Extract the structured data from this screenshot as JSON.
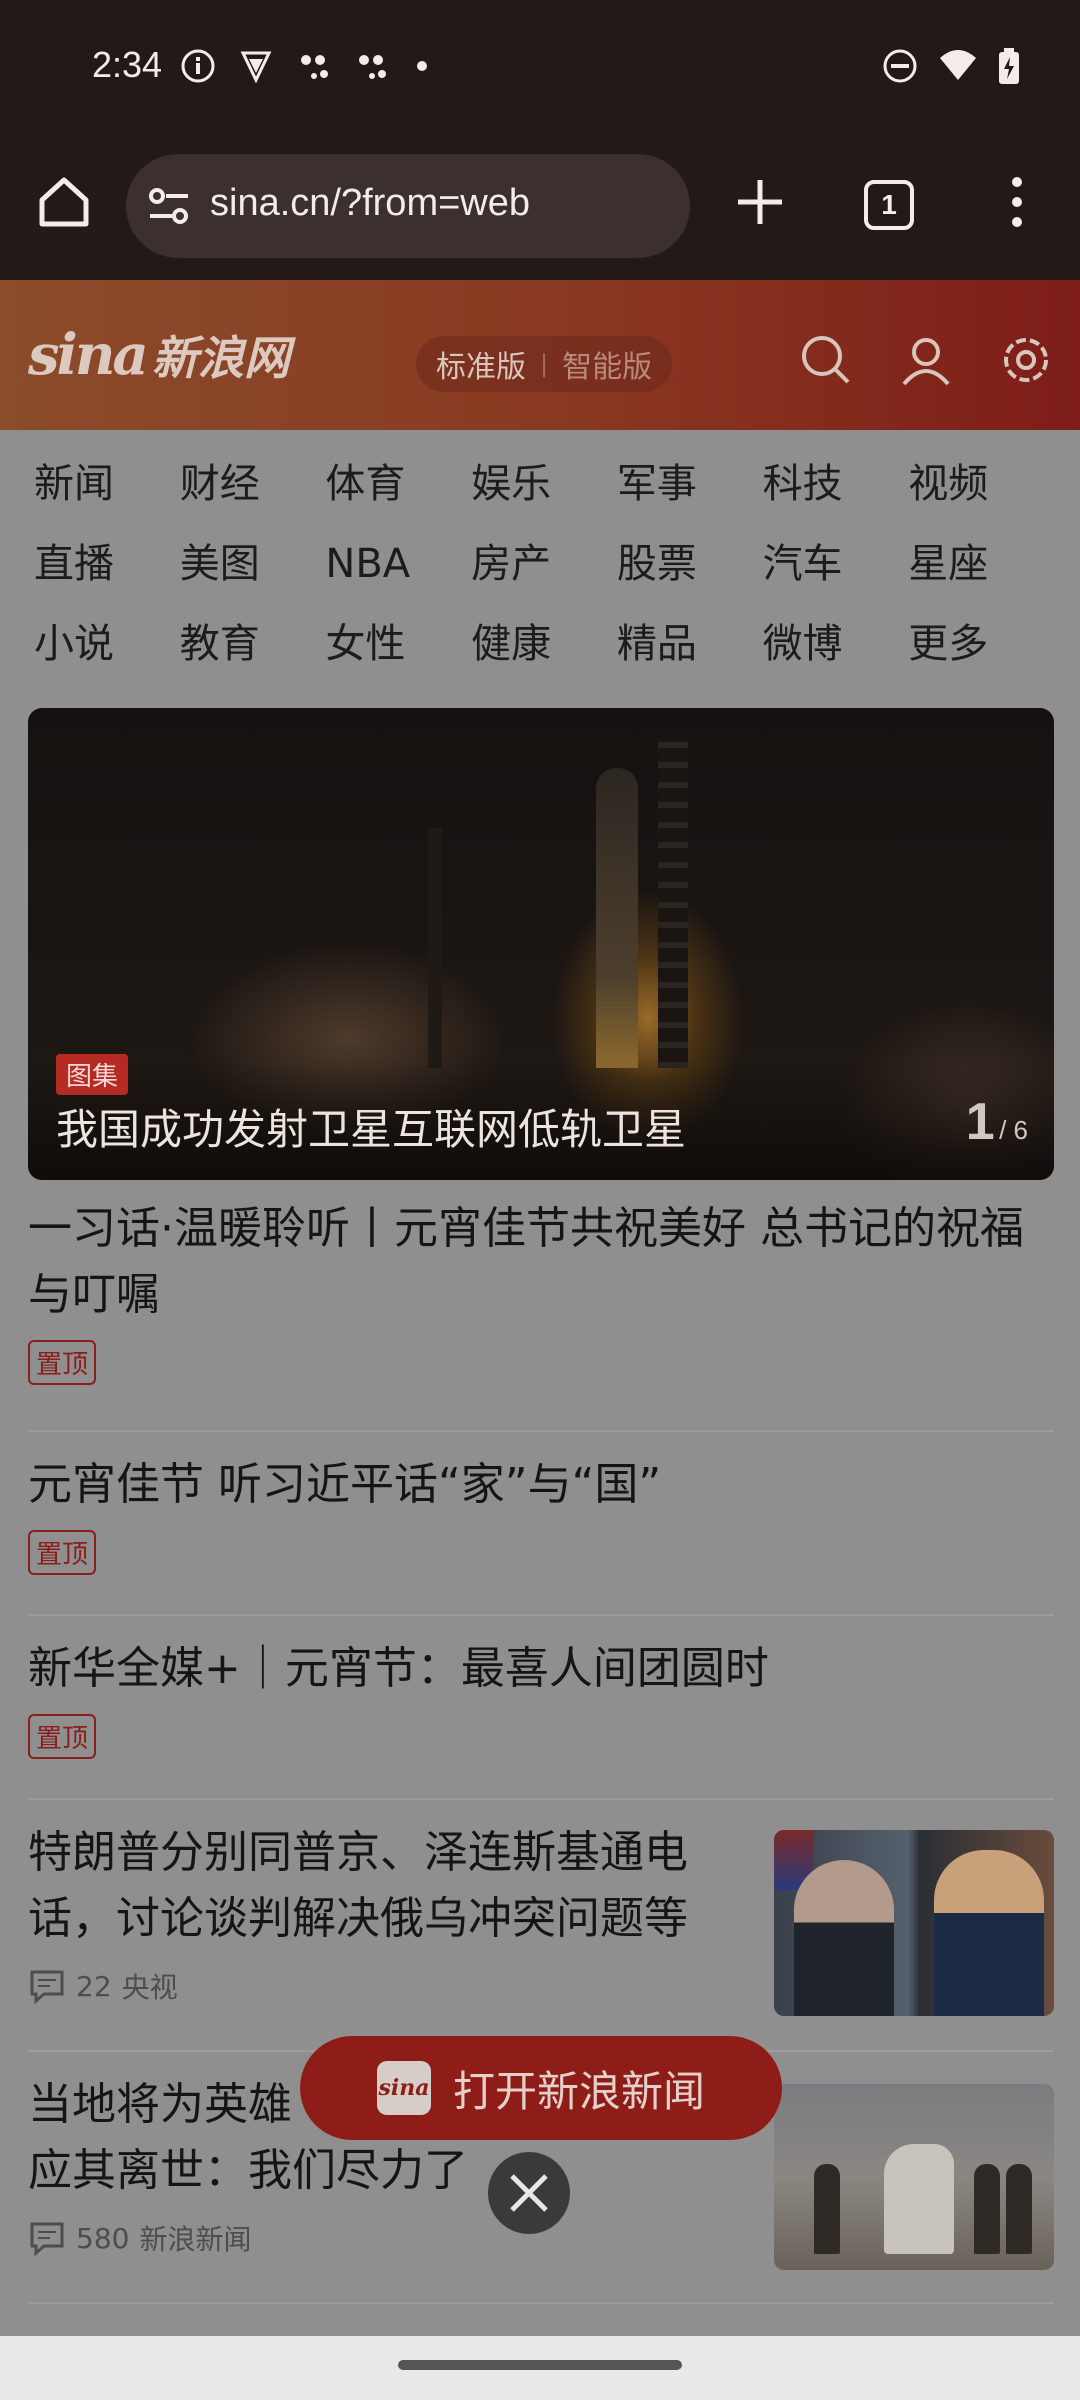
{
  "status_bar": {
    "time": "2:34"
  },
  "browser": {
    "url": "sina.cn/?from=web",
    "tab_count": "1"
  },
  "sina": {
    "mode_standard": "标准版",
    "mode_smart": "智能版",
    "categories": [
      "新闻",
      "财经",
      "体育",
      "娱乐",
      "军事",
      "科技",
      "视频",
      "直播",
      "美图",
      "NBA",
      "房产",
      "股票",
      "汽车",
      "星座",
      "小说",
      "教育",
      "女性",
      "健康",
      "精品",
      "微博",
      "更多"
    ]
  },
  "hero": {
    "badge": "图集",
    "title": "我国成功发射卫星互联网低轨卫星",
    "current": "1",
    "total": "/ 6"
  },
  "news": [
    {
      "title": "一习话·温暖聆听丨元宵佳节共祝美好 总书记的祝福与叮嘱",
      "badge": "置顶"
    },
    {
      "title": "元宵佳节 听习近平话“家”与“国”",
      "badge": "置顶"
    },
    {
      "title": "新华全媒+｜元宵节：最喜人间团圆时",
      "badge": "置顶"
    },
    {
      "title": "特朗普分别同普京、泽连斯基通电话，讨论谈判解决俄乌冲突问题等",
      "comments": "22",
      "source": "央视"
    },
    {
      "title": "当地将为英雄",
      "title_line2": "应其离世：我们尽力了",
      "comments": "580",
      "source": "新浪新闻"
    }
  ],
  "floating": {
    "label": "打开新浪新闻",
    "logo_text": "sina"
  },
  "logo": {
    "latin": "sina",
    "chinese": "新浪网"
  }
}
